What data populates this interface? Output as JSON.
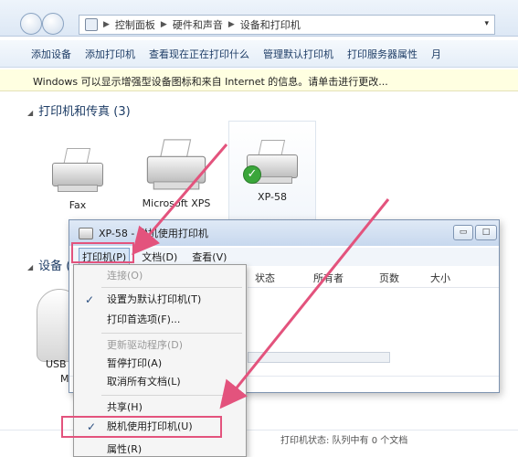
{
  "address_bar": {
    "crumbs": [
      "控制面板",
      "硬件和声音",
      "设备和打印机"
    ],
    "dropdown_glyph": "▾"
  },
  "toolbar": {
    "items": [
      "添加设备",
      "添加打印机",
      "查看现在正在打印什么",
      "管理默认打印机",
      "打印服务器属性"
    ],
    "more": "月"
  },
  "infobar": {
    "text": "Windows 可以显示增强型设备图标和来自 Internet 的信息。请单击进行更改..."
  },
  "groups": {
    "printers": "打印机和传真 (3)",
    "devices": "设备 ("
  },
  "devices": {
    "fax": "Fax",
    "xps": "Microsoft XPS",
    "xp58": "XP-58",
    "left_label_1": "USB",
    "left_label_2": "M"
  },
  "queue_window": {
    "title": "XP-58 - 脱机使用打印机",
    "menus": [
      "打印机(P)",
      "文档(D)",
      "查看(V)"
    ],
    "headers": [
      "状态",
      "所有者",
      "页数",
      "大小"
    ],
    "min_glyph": "▭",
    "max_glyph": "□"
  },
  "printer_menu": {
    "items": [
      {
        "label": "连接(O)",
        "disabled": true,
        "checked": false
      },
      {
        "label": "设置为默认打印机(T)",
        "disabled": false,
        "checked": true
      },
      {
        "label": "打印首选项(F)...",
        "disabled": false,
        "checked": false
      },
      {
        "label": "更新驱动程序(D)",
        "disabled": true,
        "checked": false
      },
      {
        "label": "暂停打印(A)",
        "disabled": false,
        "checked": false
      },
      {
        "label": "取消所有文档(L)",
        "disabled": false,
        "checked": false
      },
      {
        "label": "共享(H)",
        "disabled": false,
        "checked": false
      },
      {
        "label": "脱机使用打印机(U)",
        "disabled": false,
        "checked": true
      },
      {
        "label": "属性(R)",
        "disabled": false,
        "checked": false
      }
    ],
    "check_glyph": "✓"
  },
  "status_text": "打印机状态: 队列中有 0 个文档",
  "colors": {
    "annotation": "#e3537d",
    "accent": "#1e3d66"
  },
  "icons": {
    "default_printer_check": "✓",
    "expand_triangle": "◢"
  }
}
